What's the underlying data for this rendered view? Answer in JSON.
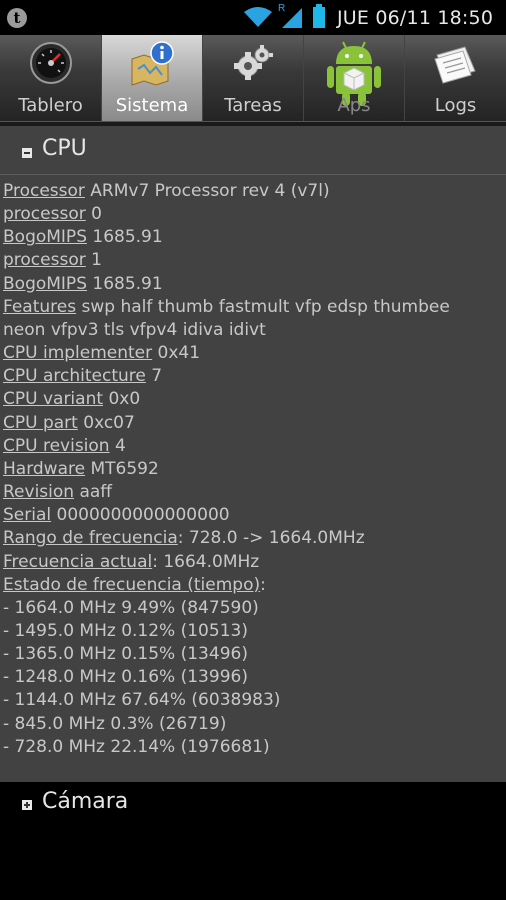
{
  "status_bar": {
    "clock": "JUE 06/11 18:50",
    "icons": [
      "app-t-icon",
      "wifi-icon",
      "signal-icon",
      "battery-icon"
    ],
    "roaming_indicator": "R"
  },
  "tabs": [
    {
      "label": "Tablero",
      "icon": "gauge-icon",
      "active": false
    },
    {
      "label": "Sistema",
      "icon": "system-map-icon",
      "active": true
    },
    {
      "label": "Tareas",
      "icon": "gears-icon",
      "active": false
    },
    {
      "label": "Aps",
      "icon": "android-icon",
      "active": false
    },
    {
      "label": "Logs",
      "icon": "notepad-icon",
      "active": false
    }
  ],
  "cpu_section": {
    "title": "CPU",
    "lines": [
      {
        "key": "Processor",
        "value": "ARMv7 Processor rev 4 (v7l)"
      },
      {
        "key": "processor",
        "value": "0"
      },
      {
        "key": "BogoMIPS",
        "value": "1685.91"
      },
      {
        "key": "processor",
        "value": "1"
      },
      {
        "key": "BogoMIPS",
        "value": "1685.91"
      },
      {
        "key": "Features",
        "value": "swp half thumb fastmult vfp edsp thumbee"
      },
      {
        "key": "",
        "value": "neon vfpv3 tls vfpv4 idiva idivt"
      },
      {
        "key": "CPU implementer",
        "value": "0x41"
      },
      {
        "key": "CPU architecture",
        "value": "7"
      },
      {
        "key": "CPU variant",
        "value": "0x0"
      },
      {
        "key": "CPU part",
        "value": "0xc07"
      },
      {
        "key": "CPU revision",
        "value": "4"
      },
      {
        "key": "Hardware",
        "value": "MT6592"
      },
      {
        "key": "Revision",
        "value": "aaff"
      },
      {
        "key": "Serial",
        "value": "0000000000000000"
      },
      {
        "key": "Rango de frecuencia",
        "value": ": 728.0 -> 1664.0MHz"
      },
      {
        "key": "Frecuencia actual",
        "value": ": 1664.0MHz"
      },
      {
        "key": "Estado de frecuencia (tiempo)",
        "value": ":"
      },
      {
        "key": "",
        "value": "- 1664.0 MHz 9.49% (847590)"
      },
      {
        "key": "",
        "value": "- 1495.0 MHz 0.12% (10513)"
      },
      {
        "key": "",
        "value": "- 1365.0 MHz 0.15% (13496)"
      },
      {
        "key": "",
        "value": "- 1248.0 MHz 0.16% (13996)"
      },
      {
        "key": "",
        "value": "- 1144.0 MHz 67.64% (6038983)"
      },
      {
        "key": "",
        "value": "- 845.0 MHz 0.3% (26719)"
      },
      {
        "key": "",
        "value": "- 728.0 MHz 22.14% (1976681)"
      }
    ]
  },
  "camara_section": {
    "title": "Cámara"
  },
  "colors": {
    "background": "#000000",
    "panel": "#424242",
    "active_tab": "#b8b8b8",
    "accent_blue": "#1fb6e8",
    "android_green": "#8ac33a"
  }
}
